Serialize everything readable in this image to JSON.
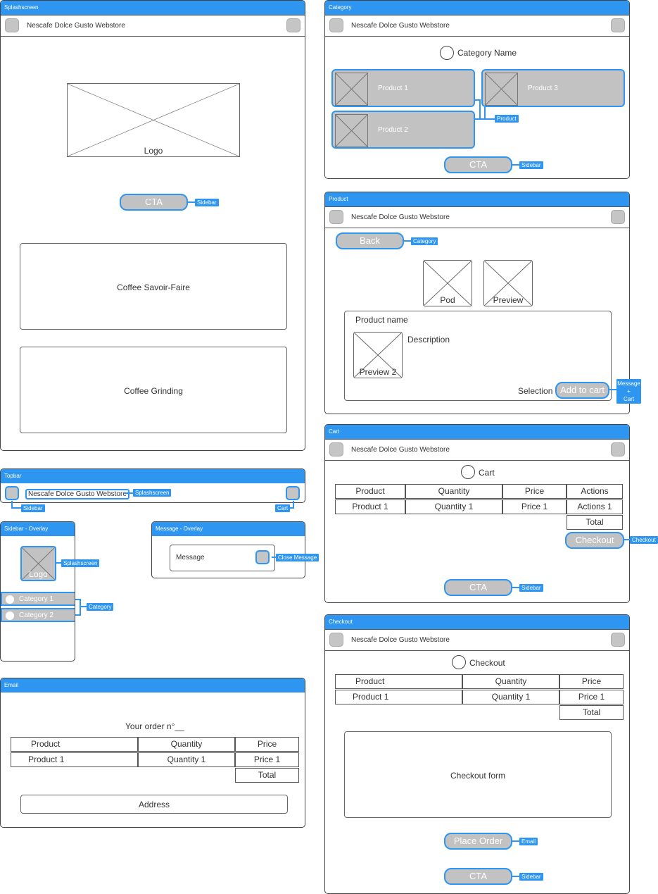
{
  "frames": {
    "splash": "Splashscreen",
    "category": "Category",
    "product": "Product",
    "cart": "Cart",
    "checkout": "Checkout",
    "topbar": "Topbar",
    "sidebar": "Sidebar - Overlay",
    "message": "Message - Overlay",
    "email": "Email"
  },
  "store_title": "Nescafe Dolce Gusto Webstore",
  "splash": {
    "logo": "Logo",
    "cta": "CTA",
    "cta_link": "Sidebar",
    "section1": "Coffee Savoir-Faire",
    "section2": "Coffee Grinding"
  },
  "category": {
    "heading": "Category Name",
    "products": [
      "Product 1",
      "Product 3",
      "Product 2"
    ],
    "product_link": "Product",
    "cta": "CTA",
    "cta_link": "Sidebar"
  },
  "product": {
    "back": "Back",
    "back_link": "Category",
    "image1": "Pod",
    "image2": "Preview",
    "name": "Product name",
    "description": "Description",
    "image3": "Preview 2",
    "selection": "Selection",
    "add_to_cart": "Add to cart",
    "add_link_lines": [
      "Message",
      "+",
      "Cart"
    ]
  },
  "cart": {
    "heading": "Cart",
    "headers": [
      "Product",
      "Quantity",
      "Price",
      "Actions"
    ],
    "row": [
      "Product 1",
      "Quantity 1",
      "Price 1",
      "Actions 1"
    ],
    "total": "Total",
    "checkout": "Checkout",
    "checkout_link": "Checkout",
    "cta": "CTA",
    "cta_link": "Sidebar"
  },
  "checkout": {
    "heading": "Checkout",
    "headers": [
      "Product",
      "Quantity",
      "Price"
    ],
    "row": [
      "Product 1",
      "Quantity 1",
      "Price 1"
    ],
    "total": "Total",
    "form": "Checkout form",
    "place_order": "Place Order",
    "place_order_link": "Email",
    "cta": "CTA",
    "cta_link": "Sidebar"
  },
  "topbar": {
    "title_link": "Splashscreen",
    "left_link": "Sidebar",
    "right_link": "Cart"
  },
  "sidebar_overlay": {
    "logo": "Logo",
    "logo_link": "Splashscreen",
    "categories": [
      "Category 1",
      "Category 2"
    ],
    "category_link": "Category"
  },
  "message_overlay": {
    "message": "Message",
    "close_link": "Close Message"
  },
  "email": {
    "heading": "Your order n°__",
    "headers": [
      "Product",
      "Quantity",
      "Price"
    ],
    "row": [
      "Product 1",
      "Quantity 1",
      "Price 1"
    ],
    "total": "Total",
    "address": "Address"
  },
  "colors": {
    "accent": "#2e95f1",
    "button_fill": "#c2c2c2"
  }
}
